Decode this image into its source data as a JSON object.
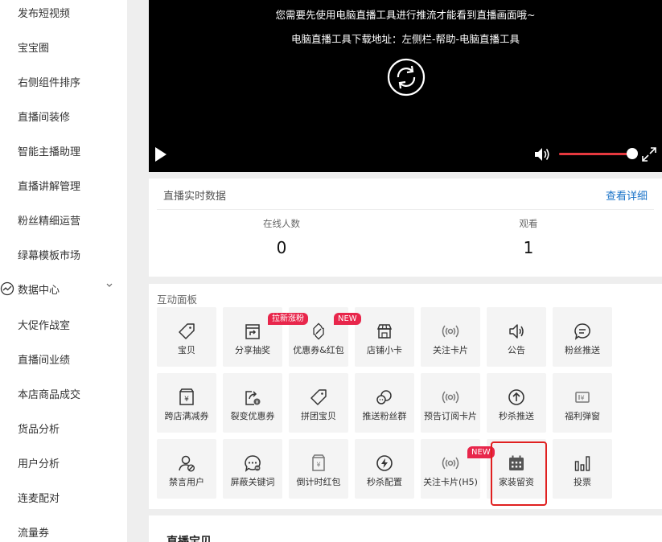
{
  "sidebar": {
    "items_top": [
      "发布短视频",
      "宝宝圈",
      "右侧组件排序",
      "直播间装修",
      "智能主播助理",
      "直播讲解管理",
      "粉丝精细运营",
      "绿幕模板市场"
    ],
    "group": {
      "label": "数据中心",
      "icon": "trend-line-icon"
    },
    "items_bottom": [
      "大促作战室",
      "直播间业绩",
      "本店商品成交",
      "货品分析",
      "用户分析",
      "连麦配对",
      "流量券"
    ]
  },
  "video": {
    "message_1": "您需要先使用电脑直播工具进行推流才能看到直播画面哦~",
    "message_2": "电脑直播工具下载地址：左侧栏-帮助-电脑直播工具",
    "volume": 1.0,
    "accent_color": "#e6393f"
  },
  "stats": {
    "title": "直播实时数据",
    "detail_link": "查看详细",
    "metrics": [
      {
        "label": "在线人数",
        "value": "0"
      },
      {
        "label": "观看",
        "value": "1"
      }
    ]
  },
  "panel": {
    "title": "互动面板",
    "tiles": [
      {
        "label": "宝贝",
        "icon": "tag-icon"
      },
      {
        "label": "分享抽奖",
        "icon": "share-lottery-icon",
        "badge": "拉新涨粉"
      },
      {
        "label": "优惠券&红包",
        "icon": "coupon-icon",
        "badge": "NEW"
      },
      {
        "label": "店铺小卡",
        "icon": "store-icon"
      },
      {
        "label": "关注卡片",
        "icon": "broadcast-icon"
      },
      {
        "label": "公告",
        "icon": "speaker-icon"
      },
      {
        "label": "粉丝推送",
        "icon": "message-icon"
      },
      {
        "label": "跨店满减券",
        "icon": "cross-store-coupon-icon"
      },
      {
        "label": "裂变优惠券",
        "icon": "fission-coupon-icon"
      },
      {
        "label": "拼团宝贝",
        "icon": "group-buy-tag-icon"
      },
      {
        "label": "推送粉丝群",
        "icon": "fan-group-icon"
      },
      {
        "label": "预告订阅卡片",
        "icon": "broadcast-icon"
      },
      {
        "label": "秒杀推送",
        "icon": "arrow-up-circle-icon"
      },
      {
        "label": "福利弹窗",
        "icon": "gift-popup-icon"
      },
      {
        "label": "禁言用户",
        "icon": "mute-user-icon"
      },
      {
        "label": "屏蔽关键词",
        "icon": "blocked-keyword-icon"
      },
      {
        "label": "倒计时红包",
        "icon": "countdown-red-envelope-icon"
      },
      {
        "label": "秒杀配置",
        "icon": "lightning-icon"
      },
      {
        "label": "关注卡片(H5)",
        "icon": "broadcast-icon",
        "badge": "NEW"
      },
      {
        "label": "家装留资",
        "icon": "calendar-icon"
      },
      {
        "label": "投票",
        "icon": "bar-chart-icon"
      }
    ]
  },
  "bottom": {
    "title": "直播宝贝"
  },
  "colors": {
    "badge": "#e8264b",
    "highlight": "#e02020",
    "link": "#1a73c8"
  }
}
